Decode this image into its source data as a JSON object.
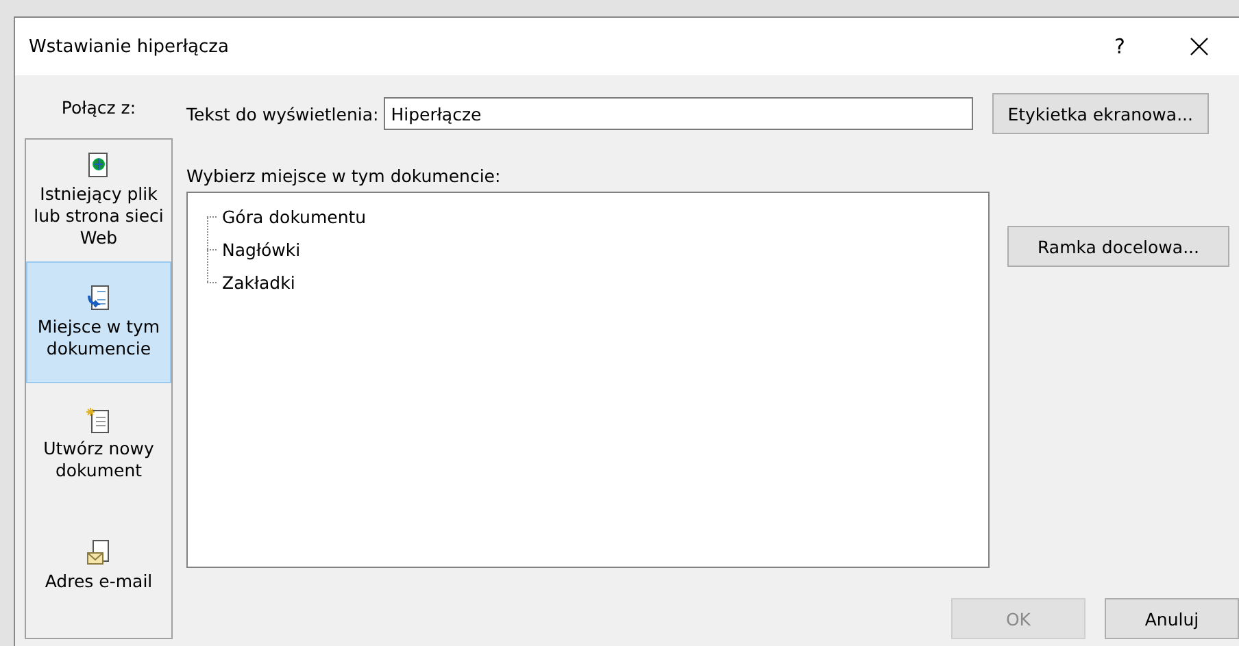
{
  "window": {
    "title": "Wstawianie hiperłącza",
    "help": "?"
  },
  "link_to": {
    "label": "Połącz z:",
    "items": [
      {
        "kind": "file",
        "label": "Istniejący plik lub strona sieci Web",
        "selected": false
      },
      {
        "kind": "place",
        "label": "Miejsce w tym dokumencie",
        "selected": true
      },
      {
        "kind": "new",
        "label": "Utwórz nowy dokument",
        "selected": false
      },
      {
        "kind": "email",
        "label": "Adres e-mail",
        "selected": false
      }
    ]
  },
  "display_text": {
    "label": "Tekst do wyświetlenia:",
    "value": "Hiperłącze"
  },
  "screen_tip_button": "Etykietka ekranowa...",
  "place": {
    "label": "Wybierz miejsce w tym dokumencie:",
    "items": [
      "Góra dokumentu",
      "Nagłówki",
      "Zakładki"
    ]
  },
  "target_frame_button": "Ramka docelowa...",
  "buttons": [
    {
      "label": "OK",
      "disabled": true
    },
    {
      "label": "Anuluj",
      "disabled": false
    }
  ]
}
